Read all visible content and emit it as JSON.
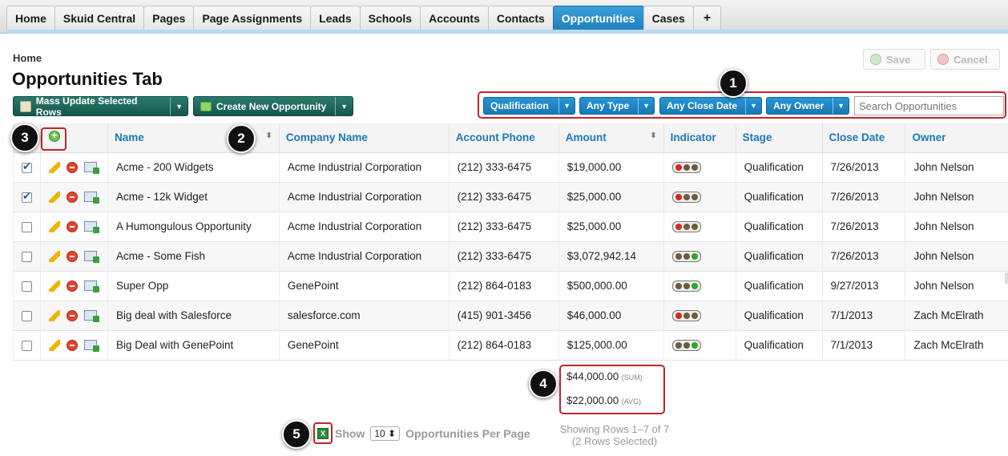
{
  "nav": {
    "tabs": [
      "Home",
      "Skuid Central",
      "Pages",
      "Page Assignments",
      "Leads",
      "Schools",
      "Accounts",
      "Contacts",
      "Opportunities",
      "Cases"
    ],
    "active": "Opportunities",
    "add_tab": "+"
  },
  "header": {
    "breadcrumb": "Home",
    "title": "Opportunities Tab",
    "save_label": "Save",
    "cancel_label": "Cancel"
  },
  "actions": {
    "mass_update": "Mass Update Selected Rows",
    "create_new": "Create New Opportunity"
  },
  "filters": {
    "items": [
      "Qualification",
      "Any Type",
      "Any Close Date",
      "Any Owner"
    ],
    "search_placeholder": "Search Opportunities"
  },
  "callouts": [
    "1",
    "2",
    "3",
    "4",
    "5"
  ],
  "table": {
    "columns": [
      "Name",
      "Company Name",
      "Account Phone",
      "Amount",
      "Indicator",
      "Stage",
      "Close Date",
      "Owner"
    ],
    "rows": [
      {
        "checked": true,
        "name": "Acme - 200 Widgets",
        "company": "Acme Industrial Corporation",
        "phone": "(212) 333-6475",
        "amount": "$19,000.00",
        "indicator": "red",
        "stage": "Qualification",
        "close": "7/26/2013",
        "owner": "John Nelson"
      },
      {
        "checked": true,
        "name": "Acme - 12k Widget",
        "company": "Acme Industrial Corporation",
        "phone": "(212) 333-6475",
        "amount": "$25,000.00",
        "indicator": "red",
        "stage": "Qualification",
        "close": "7/26/2013",
        "owner": "John Nelson"
      },
      {
        "checked": false,
        "name": "A Humongulous Opportunity",
        "company": "Acme Industrial Corporation",
        "phone": "(212) 333-6475",
        "amount": "$25,000.00",
        "indicator": "red",
        "stage": "Qualification",
        "close": "7/26/2013",
        "owner": "John Nelson"
      },
      {
        "checked": false,
        "name": "Acme - Some Fish",
        "company": "Acme Industrial Corporation",
        "phone": "(212) 333-6475",
        "amount": "$3,072,942.14",
        "indicator": "green",
        "stage": "Qualification",
        "close": "7/26/2013",
        "owner": "John Nelson"
      },
      {
        "checked": false,
        "name": "Super Opp",
        "company": "GenePoint",
        "phone": "(212) 864-0183",
        "amount": "$500,000.00",
        "indicator": "green",
        "stage": "Qualification",
        "close": "9/27/2013",
        "owner": "John Nelson"
      },
      {
        "checked": false,
        "name": "Big deal with Salesforce",
        "company": "salesforce.com",
        "phone": "(415) 901-3456",
        "amount": "$46,000.00",
        "indicator": "red",
        "stage": "Qualification",
        "close": "7/1/2013",
        "owner": "Zach McElrath"
      },
      {
        "checked": false,
        "name": "Big Deal with GenePoint",
        "company": "GenePoint",
        "phone": "(212) 864-0183",
        "amount": "$125,000.00",
        "indicator": "green",
        "stage": "Qualification",
        "close": "7/1/2013",
        "owner": "Zach McElrath"
      }
    ]
  },
  "aggregates": {
    "sum_value": "$44,000.00",
    "sum_label": "(SUM)",
    "avg_value": "$22,000.00",
    "avg_label": "(AVG)"
  },
  "footer": {
    "show_label": "Show",
    "per_page_value": "10",
    "per_page_label": "Opportunities Per Page",
    "showing_line1": "Showing Rows 1–7 of 7",
    "showing_line2": "(2 Rows Selected)"
  },
  "colors": {
    "nav_active": "#1f7fbf",
    "action_button": "#1a6358",
    "filter_button": "#2288c8",
    "header_link": "#1e78b4",
    "highlight_box": "#c1242b",
    "indicator_red": "#d8261c",
    "indicator_green": "#28a82a",
    "indicator_off": "#6e5a3c"
  }
}
